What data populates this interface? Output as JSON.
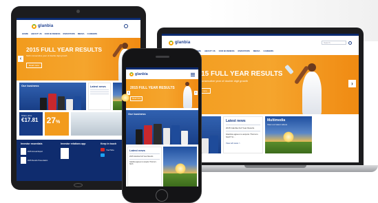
{
  "brand": {
    "name": "glanbia"
  },
  "nav": [
    "HOME",
    "ABOUT US",
    "OUR BUSINESS",
    "INVESTORS",
    "MEDIA",
    "CAREERS"
  ],
  "hero": {
    "title": "2015 FULL YEAR RESULTS",
    "subtitle": "Sixth consecutive year of double digit growth",
    "button": "Read more"
  },
  "laptop": {
    "search_placeholder": "Search",
    "tiles": {
      "news_title": "Latest news",
      "news_items": [
        "2015 Glanbia Full Year Results",
        "Glanbia agrees to acquire Thorne's Sixth* br..."
      ],
      "news_more": "View all news >",
      "multimedia_title": "Multimedia",
      "multimedia_text": "View our latest videos"
    }
  },
  "tablet": {
    "business_title": "Our business",
    "news_title": "Latest news",
    "share_price": "€17.81",
    "share_label": "Share price",
    "stat_value": "27",
    "stat_unit": "%",
    "investor_title": "Investor essentials",
    "relations_title": "Investor relations app",
    "touch_title": "Keep in touch",
    "investor_items": [
      "2015 Annual Report",
      "2015 Results Presentation"
    ],
    "social_label": "YouTube",
    "results_label": "2015 Results"
  },
  "phone": {
    "hero_title": "2015 FULL YEAR RESULTS",
    "business_title": "Our business",
    "news_title": "Latest news",
    "news_items": [
      "2015 Glanbia Full Year Results",
      "Glanbia agrees to acquire Thorne's Sixth"
    ]
  },
  "icons": [
    "search-icon",
    "left-arrow-icon",
    "right-arrow-icon",
    "menu-icon",
    "youtube-icon",
    "twitter-icon"
  ]
}
